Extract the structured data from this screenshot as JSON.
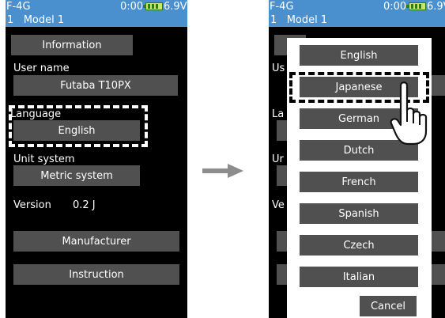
{
  "status": {
    "protocol": "F-4G",
    "model_number": "1",
    "model_name": "Model 1",
    "timer": "0:00",
    "voltage": "6.9V"
  },
  "left_screen": {
    "information_button": "Information",
    "user_name_label": "User name",
    "user_name_value": "Futaba T10PX",
    "language_label": "Language",
    "language_value": "English",
    "unit_system_label": "Unit system",
    "unit_system_value": "Metric system",
    "version_label": "Version",
    "version_value": "0.2 J",
    "manufacturer_button": "Manufacturer",
    "instruction_button": "Instruction"
  },
  "right_screen": {
    "behind_labels": {
      "user": "Us",
      "language": "La",
      "unit": "Ur",
      "version": "Ve"
    },
    "languages": [
      "English",
      "Japanese",
      "German",
      "Dutch",
      "French",
      "Spanish",
      "Czech",
      "Italian"
    ],
    "cancel_label": "Cancel"
  },
  "colors": {
    "status_bar": "#4a90cf",
    "button": "#505050",
    "background": "#000000"
  },
  "icons": {
    "arrow": "arrow-right-icon",
    "hand": "pointing-hand-icon",
    "battery": "battery-icon"
  }
}
